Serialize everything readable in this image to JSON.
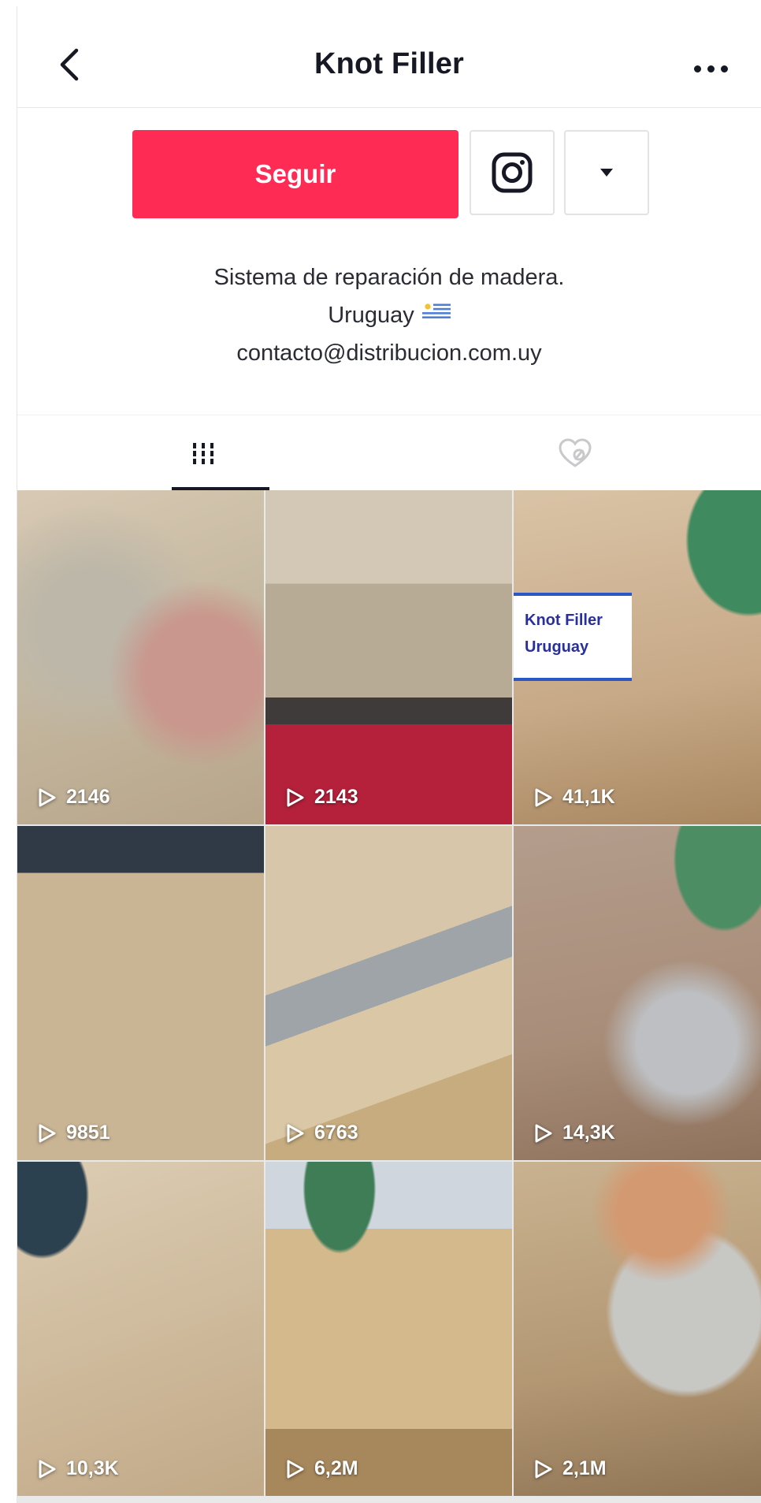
{
  "header": {
    "title": "Knot Filler",
    "back_icon": "chevron-left-icon",
    "more_icon": "more-horizontal-icon"
  },
  "actions": {
    "follow_label": "Seguir",
    "follow_color": "#fe2c55",
    "instagram_icon": "instagram-icon",
    "dropdown_icon": "caret-down-icon"
  },
  "bio": {
    "line1": "Sistema de reparación de madera.",
    "line2": "Uruguay",
    "line2_icon": "uruguay-flag-icon",
    "line3": "contacto@distribucion.com.uy"
  },
  "tabs": [
    {
      "name": "videos",
      "icon": "grid-icon",
      "active": true
    },
    {
      "name": "liked",
      "icon": "heart-hidden-icon",
      "active": false
    }
  ],
  "videos": [
    {
      "views": "2146"
    },
    {
      "views": "2143"
    },
    {
      "views": "41,1K",
      "overlay_text": [
        "Knot Filler",
        "Uruguay"
      ]
    },
    {
      "views": "9851"
    },
    {
      "views": "6763"
    },
    {
      "views": "14,3K"
    },
    {
      "views": "10,3K"
    },
    {
      "views": "6,2M"
    },
    {
      "views": "2,1M"
    }
  ]
}
